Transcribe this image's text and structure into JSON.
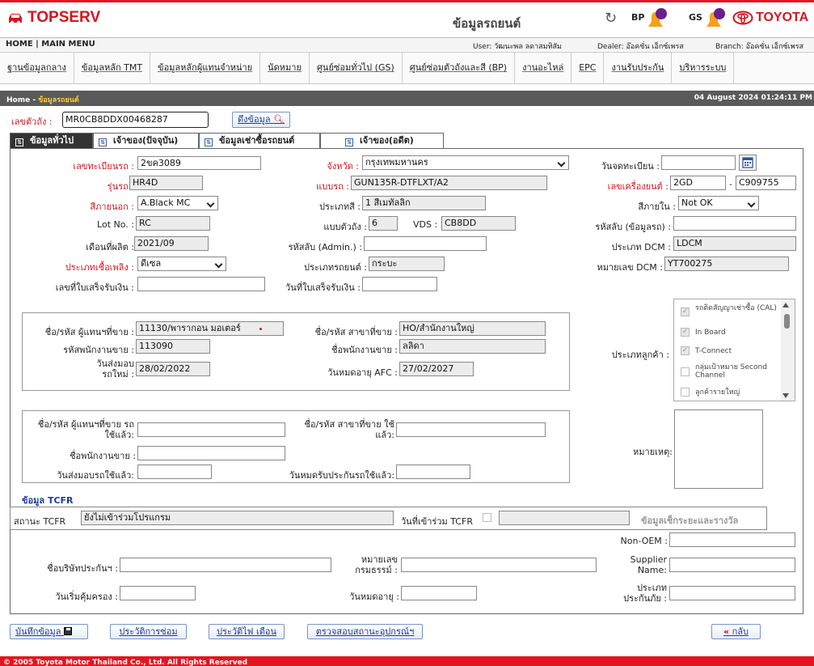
{
  "header": {
    "brand": "TOPSERV",
    "page_title": "ข้อมูลรถยนต์",
    "bp_label": "BP",
    "gs_label": "GS",
    "toyota_label": "TOYOTA"
  },
  "nav": {
    "home": "HOME | MAIN MENU",
    "user": "User:  วัฒนะพล ลดาสมทิสัม",
    "dealer": "Dealer:  อ๊อคชั่น เอ็กซ์เพรส",
    "branch": "Branch:  อ๊อคชั่น เอ็กซ์เพรส"
  },
  "menu": [
    "ฐานข้อมูลกลาง",
    "ข้อมูลหลัก TMT",
    "ข้อมูลหลักผู้แทนจำหน่าย",
    "นัดหมาย",
    "ศูนย์ซ่อมทั่วไป (GS)",
    "ศูนย์ซ่อมตัวถังและสี (BP)",
    "งานอะไหล่",
    "EPC",
    "งานรับประกัน",
    "บริหารระบบ"
  ],
  "breadcrumb": {
    "home": "Home - ",
    "current": "ข้อมูลรถยนต์",
    "datetime": "04 August 2024 01:24:11 PM"
  },
  "search": {
    "label": "เลขตัวถัง :",
    "value": "MR0CB8DDX00468287",
    "button": "ดึงข้อมูล"
  },
  "tabs": [
    "ข้อมูลทั่วไป",
    "เจ้าของ(ปัจจุบัน)",
    "ข้อมูลเช่าซื้อรถยนต์",
    "เจ้าของ(อดีต)"
  ],
  "general": {
    "reg_label": "เลขทะเบียนรถ :",
    "reg_value": "2ขค3089",
    "province_label": "จังหวัด :",
    "province_value": "กรุงเทพมหานคร",
    "regdate_label": "วันจดทะเบียน :",
    "regdate_value": "",
    "model_label": "รุ่นรถ :",
    "model_value": "HR4D",
    "type_label": "แบบรถ :",
    "type_value": "GUN135R-DTFLXT/A2",
    "engine_label": "เลขเครื่องยนต์ :",
    "engine_value1": "2GD",
    "engine_sep": "-",
    "engine_value2": "C909755",
    "ext_color_label": "สีภายนอก :",
    "ext_color_value": "A.Black MC",
    "color_type_label": "ประเภทสี :",
    "color_type_value": "1 สีเมทัลลิก",
    "int_color_label": "สีภายใน :",
    "int_color_value": "Not OK",
    "lot_label": "Lot No. :",
    "lot_value": "RC",
    "body_type_label": "แบบตัวถัง :",
    "body_type_value": "6",
    "vds_label": "VDS :",
    "vds_value": "CB8DD",
    "code_car_label": "รหัสลับ (ข้อมูลรถ) :",
    "code_car_value": "",
    "mfg_label": "เดือนที่ผลิต :",
    "mfg_value": "2021/09",
    "code_admin_label": "รหัสลับ (Admin.) :",
    "code_admin_value": "",
    "dcm_type_label": "ประเภท DCM :",
    "dcm_type_value": "LDCM",
    "fuel_label": "ประเภทเชื้อเพลิง :",
    "fuel_value": "ดีเซล",
    "car_type_label": "ประเภทรถยนต์ :",
    "car_type_value": "กระบะ",
    "dcm_no_label": "หมายเลข DCM :",
    "dcm_no_value": "YT700275",
    "receipt_no_label": "เลขที่ใบเสร็จรับเงิน :",
    "receipt_no_value": "",
    "receipt_date_label": "วันที่ใบเสร็จรับเงิน :",
    "receipt_date_value": ""
  },
  "dealer": {
    "dealer_label": "ชื่อ/รหัส ผู้แทนฯที่ขาย :",
    "dealer_value": "11130/พารากอน มอเตอร์",
    "branch_label": "ชื่อ/รหัส สาขาที่ขาย :",
    "branch_value": "HO/สำนักงานใหญ่",
    "staff_code_label": "รหัสพนักงานขาย :",
    "staff_code_value": "113090",
    "staff_name_label": "ชื่อพนักงานขาย :",
    "staff_name_value": "ลลิดา",
    "delivery_label_1": "วันส่งมอบ",
    "delivery_label_2": "รถใหม่ :",
    "delivery_value": "28/02/2022",
    "afc_label": "วันหมดอายุ AFC :",
    "afc_value": "27/02/2027"
  },
  "customer_types": {
    "label": "ประเภทลูกค้า :",
    "items": [
      {
        "label": "รถติดสัญญาเช่าซื้อ (CAL)",
        "checked": true
      },
      {
        "label": "In Board",
        "checked": true
      },
      {
        "label": "T-Connect",
        "checked": true
      },
      {
        "label": "กลุ่มเป้าหมาย Second Channel",
        "checked": false
      },
      {
        "label": "ลูกค้ารายใหญ่",
        "checked": false
      }
    ]
  },
  "used": {
    "dealer_label_1": "ชื่อ/รหัส ผู้แทนฯที่ขาย รถ",
    "dealer_label_2": "ใช้แล้ว:",
    "dealer_value": "",
    "branch_label_1": "ชื่อ/รหัส สาขาที่ขาย ใช้",
    "branch_label_2": "แล้ว:",
    "branch_value": "",
    "staff_label": "ชื่อพนักงานขาย :",
    "staff_value": "",
    "delivery_label": "วันส่งมอบรถใช้แล้ว:",
    "delivery_value": "",
    "warranty_label": "วันหมดรับประกันรถใช้แล้ว:",
    "warranty_value": "",
    "remark_label": "หมายเหตุ:"
  },
  "tcfr": {
    "title": "ข้อมูล TCFR",
    "status_label": "สถานะ TCFR",
    "status_value": "ยังไม่เข้าร่วมโปรแกรม",
    "join_label": "วันที่เข้าร่วม TCFR",
    "join_value": "",
    "check_link": "ข้อมูลเช็กระยะและรางวัล"
  },
  "insurance": {
    "non_oem_label": "Non-OEM :",
    "non_oem_value": "",
    "company_label": "ชื่อบริษัทประกันฯ :",
    "company_value": "",
    "policy_label_1": "หมายเลข",
    "policy_label_2": "กรมธรรม์ :",
    "policy_value": "",
    "supplier_label_1": "Supplier",
    "supplier_label_2": "Name:",
    "supplier_value": "",
    "start_label": "วันเริ่มคุ้มครอง :",
    "start_value": "",
    "expire_label": "วันหมดอายุ :",
    "expire_value": "",
    "ins_type_label_1": "ประเภท",
    "ins_type_label_2": "ประกันภัย :",
    "ins_type_value": ""
  },
  "actions": {
    "save": "บันทึกข้อมูล",
    "repair": "ประวัติการซ่อม",
    "alert": "ประวัติไฟ เตือน",
    "device": "ตรวจสอบสถานะอุปกรณ์ฯ",
    "back": "กลับ"
  },
  "footer": "© 2005 Toyota Motor Thailand Co., Ltd. All Rights Reserved"
}
